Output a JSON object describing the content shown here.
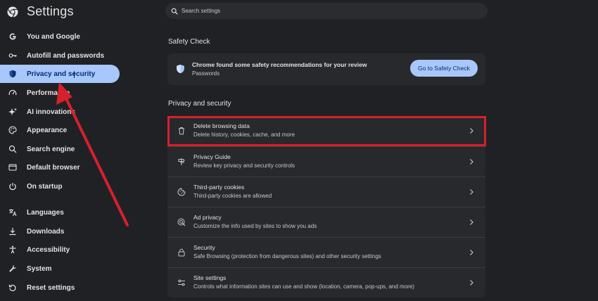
{
  "app": {
    "title": "Settings",
    "logo_icon": "chrome-logo-icon"
  },
  "sidebar": {
    "items": [
      {
        "label": "You and Google",
        "icon": "google-g-icon"
      },
      {
        "label": "Autofill and passwords",
        "icon": "key-icon"
      },
      {
        "label": "Privacy and security",
        "icon": "shield-icon",
        "active": true
      },
      {
        "label": "Performance",
        "icon": "speedometer-icon"
      },
      {
        "label": "AI innovations",
        "icon": "sparkle-icon"
      },
      {
        "label": "Appearance",
        "icon": "palette-icon"
      },
      {
        "label": "Search engine",
        "icon": "search-icon"
      },
      {
        "label": "Default browser",
        "icon": "browser-window-icon"
      },
      {
        "label": "On startup",
        "icon": "power-icon"
      },
      {
        "label": "Languages",
        "icon": "translate-icon"
      },
      {
        "label": "Downloads",
        "icon": "download-icon"
      },
      {
        "label": "Accessibility",
        "icon": "accessibility-icon"
      },
      {
        "label": "System",
        "icon": "wrench-icon"
      },
      {
        "label": "Reset settings",
        "icon": "reset-icon"
      }
    ]
  },
  "search": {
    "placeholder": "Search settings"
  },
  "safety_check": {
    "section_title": "Safety Check",
    "message": "Chrome found some safety recommendations for your review",
    "subtext": "Passwords",
    "button_label": "Go to Safety Check"
  },
  "privacy": {
    "section_title": "Privacy and security",
    "rows": [
      {
        "title": "Delete browsing data",
        "subtitle": "Delete history, cookies, cache, and more",
        "icon": "trash-icon"
      },
      {
        "title": "Privacy Guide",
        "subtitle": "Review key privacy and security controls",
        "icon": "signpost-icon"
      },
      {
        "title": "Third-party cookies",
        "subtitle": "Third-party cookies are allowed",
        "icon": "cookie-icon"
      },
      {
        "title": "Ad privacy",
        "subtitle": "Customize the info used by sites to show you ads",
        "icon": "ad-privacy-icon"
      },
      {
        "title": "Security",
        "subtitle": "Safe Browsing (protection from dangerous sites) and other security settings",
        "icon": "lock-icon"
      },
      {
        "title": "Site settings",
        "subtitle": "Controls what information sites can use and show (location, camera, pop-ups, and more)",
        "icon": "sliders-icon"
      }
    ]
  },
  "colors": {
    "background": "#202124",
    "card": "#28292c",
    "accent": "#a8c7fa",
    "accent_text": "#062e6f",
    "annotation_red": "#d6202d"
  }
}
